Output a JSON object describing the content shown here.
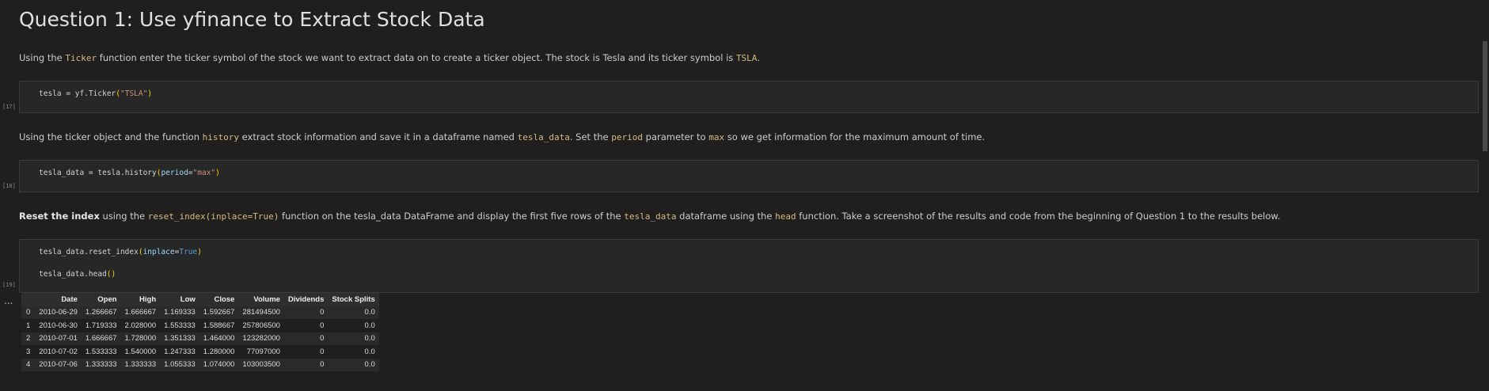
{
  "heading": "Question 1: Use yfinance to Extract Stock Data",
  "para1": {
    "t1": "Using the ",
    "c1": "Ticker",
    "t2": " function enter the ticker symbol of the stock we want to extract data on to create a ticker object. The stock is Tesla and its ticker symbol is ",
    "c2": "TSLA",
    "t3": "."
  },
  "cell17": {
    "count": "[17]",
    "var": "tesla",
    "eq": " = ",
    "call": "yf.Ticker",
    "open": "(",
    "arg": "\"TSLA\"",
    "close": ")"
  },
  "para2": {
    "t1": "Using the ticker object and the function ",
    "c1": "history",
    "t2": " extract stock information and save it in a dataframe named ",
    "c2": "tesla_data",
    "t3": ". Set the ",
    "c3": "period",
    "t4": " parameter to ",
    "c4": "max",
    "t5": " so we get information for the maximum amount of time."
  },
  "cell18": {
    "count": "[18]",
    "var": "tesla_data",
    "eq": " = ",
    "call": "tesla.history",
    "open": "(",
    "kw": "period",
    "kweq": "=",
    "arg": "\"max\"",
    "close": ")"
  },
  "para3": {
    "bold": "Reset the index",
    "t1": " using the ",
    "c1": "reset_index(inplace=True)",
    "t2": " function on the tesla_data DataFrame and display the first five rows of the ",
    "c2": "tesla_data",
    "t3": " dataframe using the ",
    "c3": "head",
    "t4": " function. Take a screenshot of the results and code from the beginning of Question 1 to the results below."
  },
  "cell19": {
    "count": "[19]",
    "line1_call": "tesla_data.reset_index",
    "line1_open": "(",
    "line1_kw": "inplace",
    "line1_eq": "=",
    "line1_val": "True",
    "line1_close": ")",
    "line2_call": "tesla_data.head",
    "line2_parens": "()"
  },
  "output_ellipsis": "...",
  "table": {
    "columns": [
      "",
      "Date",
      "Open",
      "High",
      "Low",
      "Close",
      "Volume",
      "Dividends",
      "Stock Splits"
    ],
    "rows": [
      [
        "0",
        "2010-06-29",
        "1.266667",
        "1.666667",
        "1.169333",
        "1.592667",
        "281494500",
        "0",
        "0.0"
      ],
      [
        "1",
        "2010-06-30",
        "1.719333",
        "2.028000",
        "1.553333",
        "1.588667",
        "257806500",
        "0",
        "0.0"
      ],
      [
        "2",
        "2010-07-01",
        "1.666667",
        "1.728000",
        "1.351333",
        "1.464000",
        "123282000",
        "0",
        "0.0"
      ],
      [
        "3",
        "2010-07-02",
        "1.533333",
        "1.540000",
        "1.247333",
        "1.280000",
        "77097000",
        "0",
        "0.0"
      ],
      [
        "4",
        "2010-07-06",
        "1.333333",
        "1.333333",
        "1.055333",
        "1.074000",
        "103003500",
        "0",
        "0.0"
      ]
    ]
  }
}
